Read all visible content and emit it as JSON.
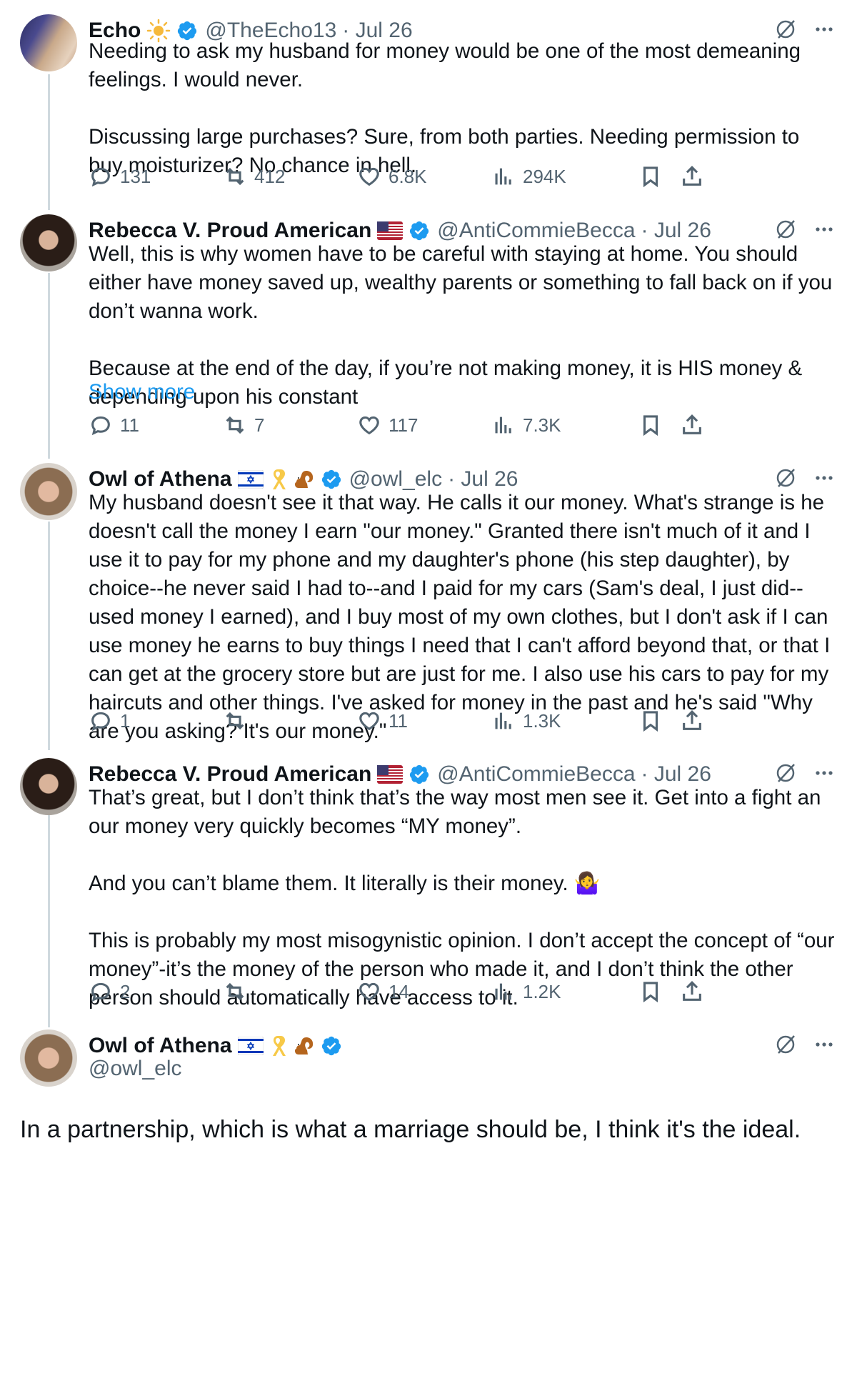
{
  "tweets": [
    {
      "name": "Echo",
      "handle": "@TheEcho13",
      "date": "· Jul 26",
      "text": "Needing to ask my husband for money would be one of the most demeaning feelings. I would never.\n\nDiscussing large purchases? Sure, from both parties. Needing permission to buy moisturizer? No chance in hell.",
      "replies": "131",
      "reposts": "412",
      "likes": "6.8K",
      "views": "294K"
    },
    {
      "name": "Rebecca V. Proud American",
      "handle": "@AntiCommieBecca",
      "date": "· Jul 26",
      "text": "Well, this is why women have to be careful with staying at home. You should either have money saved up, wealthy parents or something to fall back on if you don’t wanna work.\n\nBecause at the end of the day, if you’re not making money, it is HIS money & depending upon his constant",
      "show_more": "Show more",
      "replies": "11",
      "reposts": "7",
      "likes": "117",
      "views": "7.3K"
    },
    {
      "name": "Owl of Athena",
      "handle": "@owl_elc",
      "date": "· Jul 26",
      "text": "My husband doesn't see it that way. He calls it our money. What's strange is he doesn't call the money I earn \"our money.\" Granted there isn't much of it and I use it to pay for my phone and my daughter's phone (his step daughter), by choice--he never said I had to--and I paid for my cars (Sam's deal, I just did--used money I earned), and I buy most of my own clothes, but I don't ask if I can use money he earns to buy things I need that I can't afford beyond that, or that I can get at the grocery store but are just for me. I also use his cars to pay for my haircuts and other things. I've asked for money in the past and he's said \"Why are you asking? It's our money.\"",
      "replies": "1",
      "reposts": "",
      "likes": "11",
      "views": "1.3K"
    },
    {
      "name": "Rebecca V. Proud American",
      "handle": "@AntiCommieBecca",
      "date": "· Jul 26",
      "text": "That’s great, but I don’t think that’s the way most men see it. Get into a fight an our money very quickly becomes “MY money”.\n\nAnd you can’t blame them. It literally is their money. 🤷‍♀️\n\nThis is probably my most misogynistic opinion. I don’t accept the concept of “our money”-it’s the money of the person who made it, and I don’t think the other person should automatically have access to it.",
      "replies": "2",
      "reposts": "",
      "likes": "14",
      "views": "1.2K"
    }
  ],
  "focused": {
    "name": "Owl of Athena",
    "handle": "@owl_elc",
    "text": "In a partnership, which is what a marriage should be, I think it's the ideal."
  },
  "colors": {
    "verified": "#1d9bf0",
    "text": "#0f1419",
    "muted": "#536471",
    "link": "#1d9bf0"
  },
  "icons": [
    "reply-icon",
    "repost-icon",
    "like-icon",
    "views-icon",
    "bookmark-icon",
    "share-icon",
    "grok-icon",
    "more-icon",
    "verified-icon",
    "us-flag-icon",
    "israel-flag-icon",
    "ribbon-icon",
    "squirrel-icon",
    "sun-icon"
  ]
}
